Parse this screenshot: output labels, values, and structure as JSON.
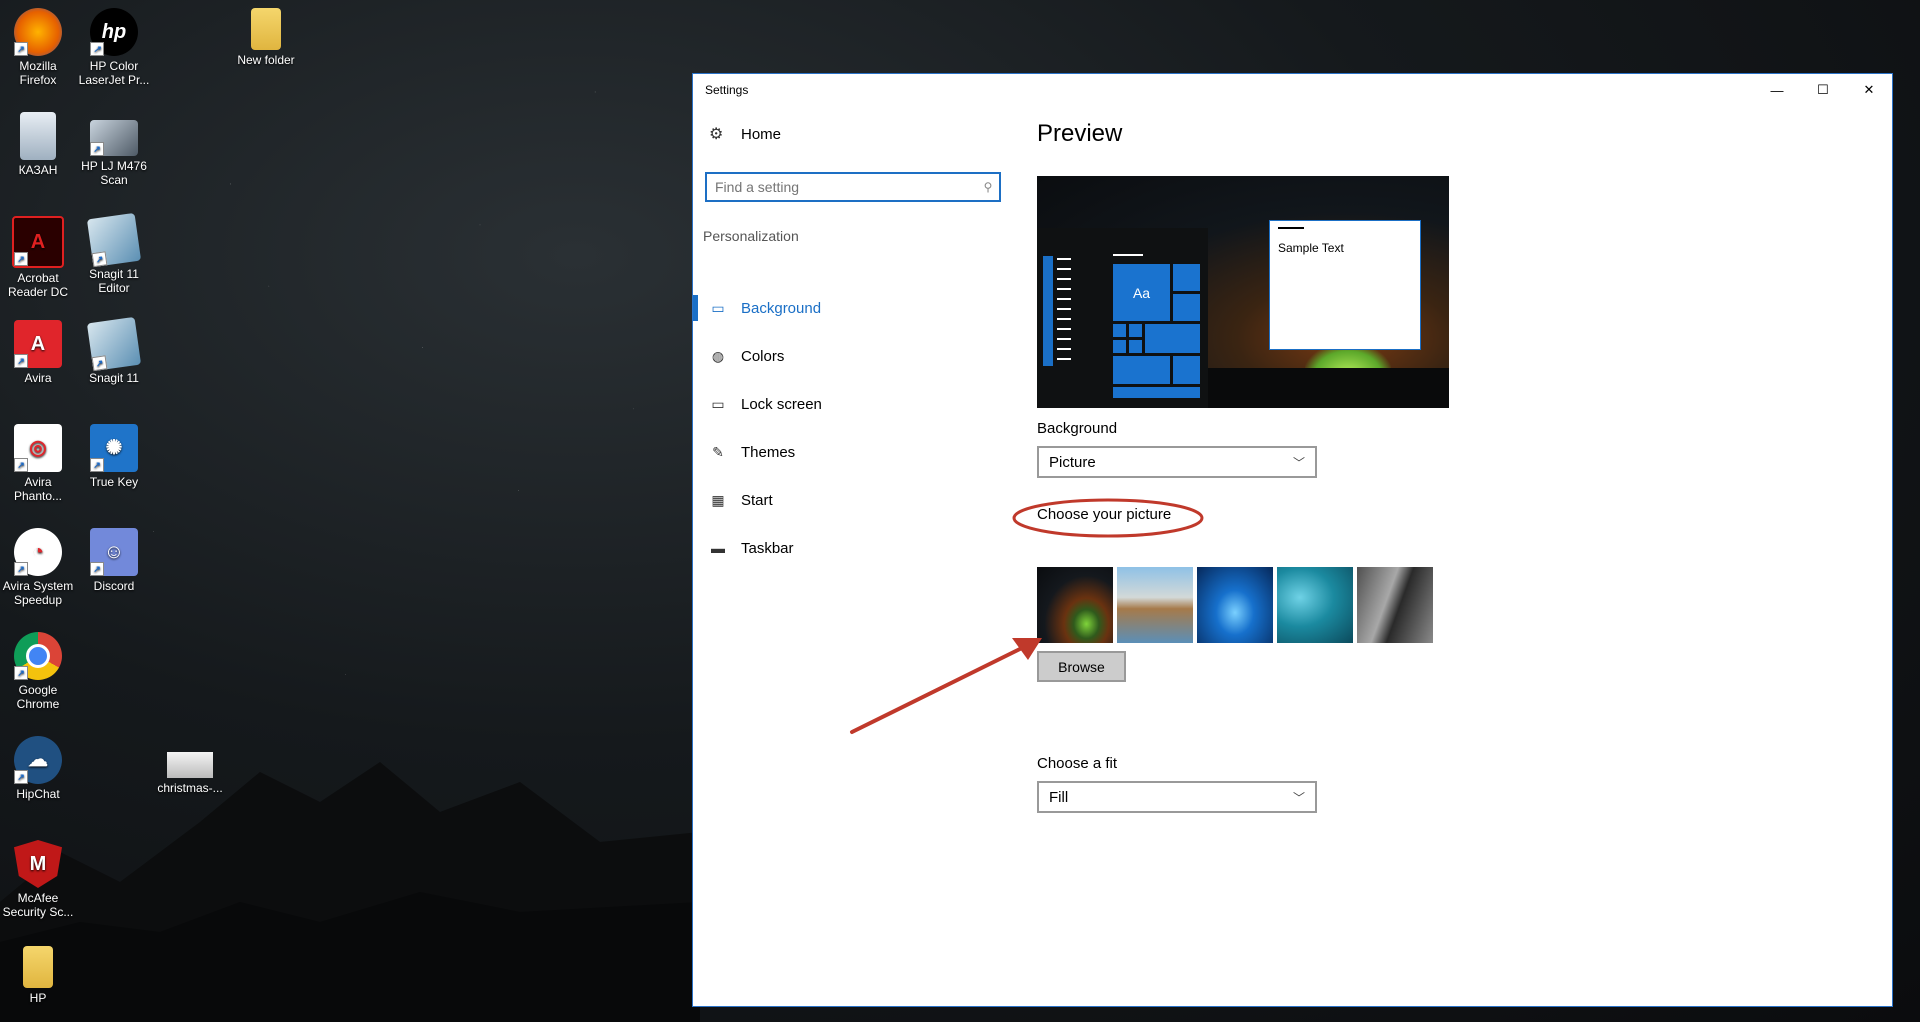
{
  "desktop": {
    "icons": [
      {
        "label": "Mozilla Firefox"
      },
      {
        "label": "HP Color LaserJet Pr..."
      },
      {
        "label": "New folder"
      },
      {
        "label": "КАЗАН"
      },
      {
        "label": "HP LJ M476 Scan"
      },
      {
        "label": "Acrobat Reader DC"
      },
      {
        "label": "Snagit 11 Editor"
      },
      {
        "label": "Avira"
      },
      {
        "label": "Snagit 11"
      },
      {
        "label": "Avira Phanto..."
      },
      {
        "label": "True Key"
      },
      {
        "label": "Avira System Speedup"
      },
      {
        "label": "Discord"
      },
      {
        "label": "Google Chrome"
      },
      {
        "label": "HipChat"
      },
      {
        "label": "christmas-..."
      },
      {
        "label": "McAfee Security Sc..."
      },
      {
        "label": "HP"
      }
    ]
  },
  "window": {
    "title": "Settings",
    "controls": {
      "minimize": "—",
      "maximize": "☐",
      "close": "✕"
    }
  },
  "nav": {
    "home": "Home",
    "search_placeholder": "Find a setting",
    "section": "Personalization",
    "items": [
      {
        "label": "Background",
        "icon": "image-icon",
        "active": true
      },
      {
        "label": "Colors",
        "icon": "palette-icon"
      },
      {
        "label": "Lock screen",
        "icon": "lock-screen-icon"
      },
      {
        "label": "Themes",
        "icon": "themes-icon"
      },
      {
        "label": "Start",
        "icon": "start-icon"
      },
      {
        "label": "Taskbar",
        "icon": "taskbar-icon"
      }
    ]
  },
  "content": {
    "preview_title": "Preview",
    "preview_tile_text": "Aa",
    "preview_sample_text": "Sample Text",
    "background_label": "Background",
    "background_value": "Picture",
    "choose_picture_label": "Choose your picture",
    "browse_label": "Browse",
    "fit_label": "Choose a fit",
    "fit_value": "Fill"
  },
  "colors": {
    "accent": "#1a6fc6",
    "annotation": "#c0392b"
  }
}
